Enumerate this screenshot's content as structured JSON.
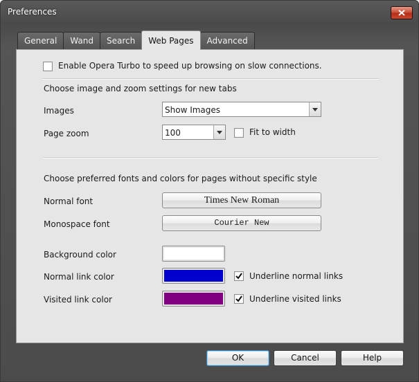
{
  "window": {
    "title": "Preferences"
  },
  "tabs": [
    {
      "label": "General",
      "active": false
    },
    {
      "label": "Wand",
      "active": false
    },
    {
      "label": "Search",
      "active": false
    },
    {
      "label": "Web Pages",
      "active": true
    },
    {
      "label": "Advanced",
      "active": false
    }
  ],
  "turbo": {
    "label": "Enable Opera Turbo to speed up browsing on slow connections.",
    "checked": false
  },
  "zoom_section": {
    "heading": "Choose image and zoom settings for new tabs",
    "images_label": "Images",
    "images_value": "Show Images",
    "page_zoom_label": "Page zoom",
    "page_zoom_value": "100",
    "fit_to_width_label": "Fit to width",
    "fit_to_width_checked": false
  },
  "fonts_section": {
    "heading": "Choose preferred fonts and colors for pages without specific style",
    "normal_font_label": "Normal font",
    "normal_font_value": "Times New Roman",
    "monospace_font_label": "Monospace font",
    "monospace_font_value": "Courier New",
    "background_color_label": "Background color",
    "background_color": "#ffffff",
    "normal_link_color_label": "Normal link color",
    "normal_link_color": "#0000cc",
    "underline_normal_label": "Underline normal links",
    "underline_normal_checked": true,
    "visited_link_color_label": "Visited link color",
    "visited_link_color": "#800080",
    "underline_visited_label": "Underline visited links",
    "underline_visited_checked": true
  },
  "buttons": {
    "ok": "OK",
    "cancel": "Cancel",
    "help": "Help"
  }
}
